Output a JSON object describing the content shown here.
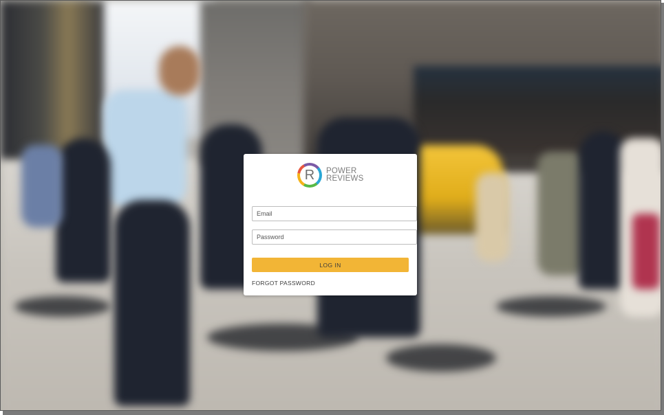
{
  "brand": {
    "logo_letter": "R",
    "name_line1": "POWER",
    "name_line2": "REVIEWS",
    "colors": [
      "#7b5aa6",
      "#2aa7d6",
      "#58b947",
      "#f5b31a",
      "#e8573f"
    ]
  },
  "login": {
    "email_placeholder": "Email",
    "password_placeholder": "Password",
    "submit_label": "LOG IN",
    "forgot_label": "FORGOT PASSWORD",
    "accent_color": "#f2b536"
  },
  "background": {
    "icon": "blurred-city-street-photo"
  }
}
